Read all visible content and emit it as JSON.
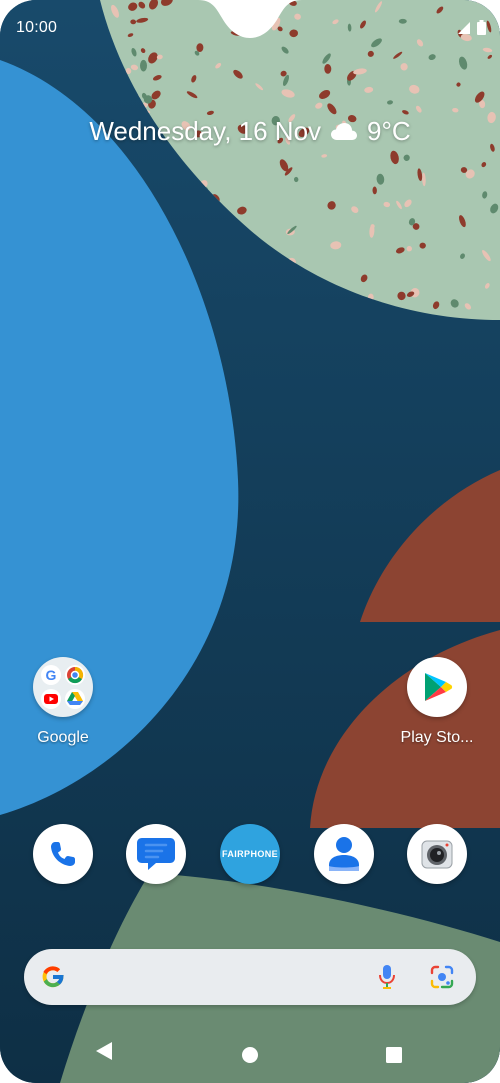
{
  "status_bar": {
    "time": "10:00",
    "icons": [
      "signal-icon",
      "battery-icon"
    ]
  },
  "glance": {
    "date": "Wednesday, 16 Nov",
    "weather_icon": "cloud-icon",
    "temperature": "9°C"
  },
  "home_apps": [
    {
      "label": "Google",
      "icon": "google-folder-icon"
    },
    {
      "label": "Play Sto...",
      "icon": "play-store-icon"
    }
  ],
  "dock": [
    {
      "name": "phone",
      "icon": "phone-icon"
    },
    {
      "name": "messages",
      "icon": "messages-icon"
    },
    {
      "name": "fairphone",
      "icon": "fairphone-icon",
      "text": "FAIRPHONE"
    },
    {
      "name": "contacts",
      "icon": "contacts-icon"
    },
    {
      "name": "camera",
      "icon": "camera-icon"
    }
  ],
  "search_bar": {
    "icons": [
      "google-g-icon",
      "microphone-icon",
      "lens-icon"
    ]
  },
  "navigation": [
    "back-icon",
    "home-icon",
    "recents-icon"
  ],
  "colors": {
    "wallpaper_dark": "#123f5e",
    "wallpaper_blue": "#3592d3",
    "wallpaper_terrazzo": "#a9c7b1",
    "wallpaper_rust": "#8c4432",
    "wallpaper_green": "#6a8b72",
    "search_bar": "#e9ecef",
    "fairphone_blue": "#2fa3df"
  }
}
